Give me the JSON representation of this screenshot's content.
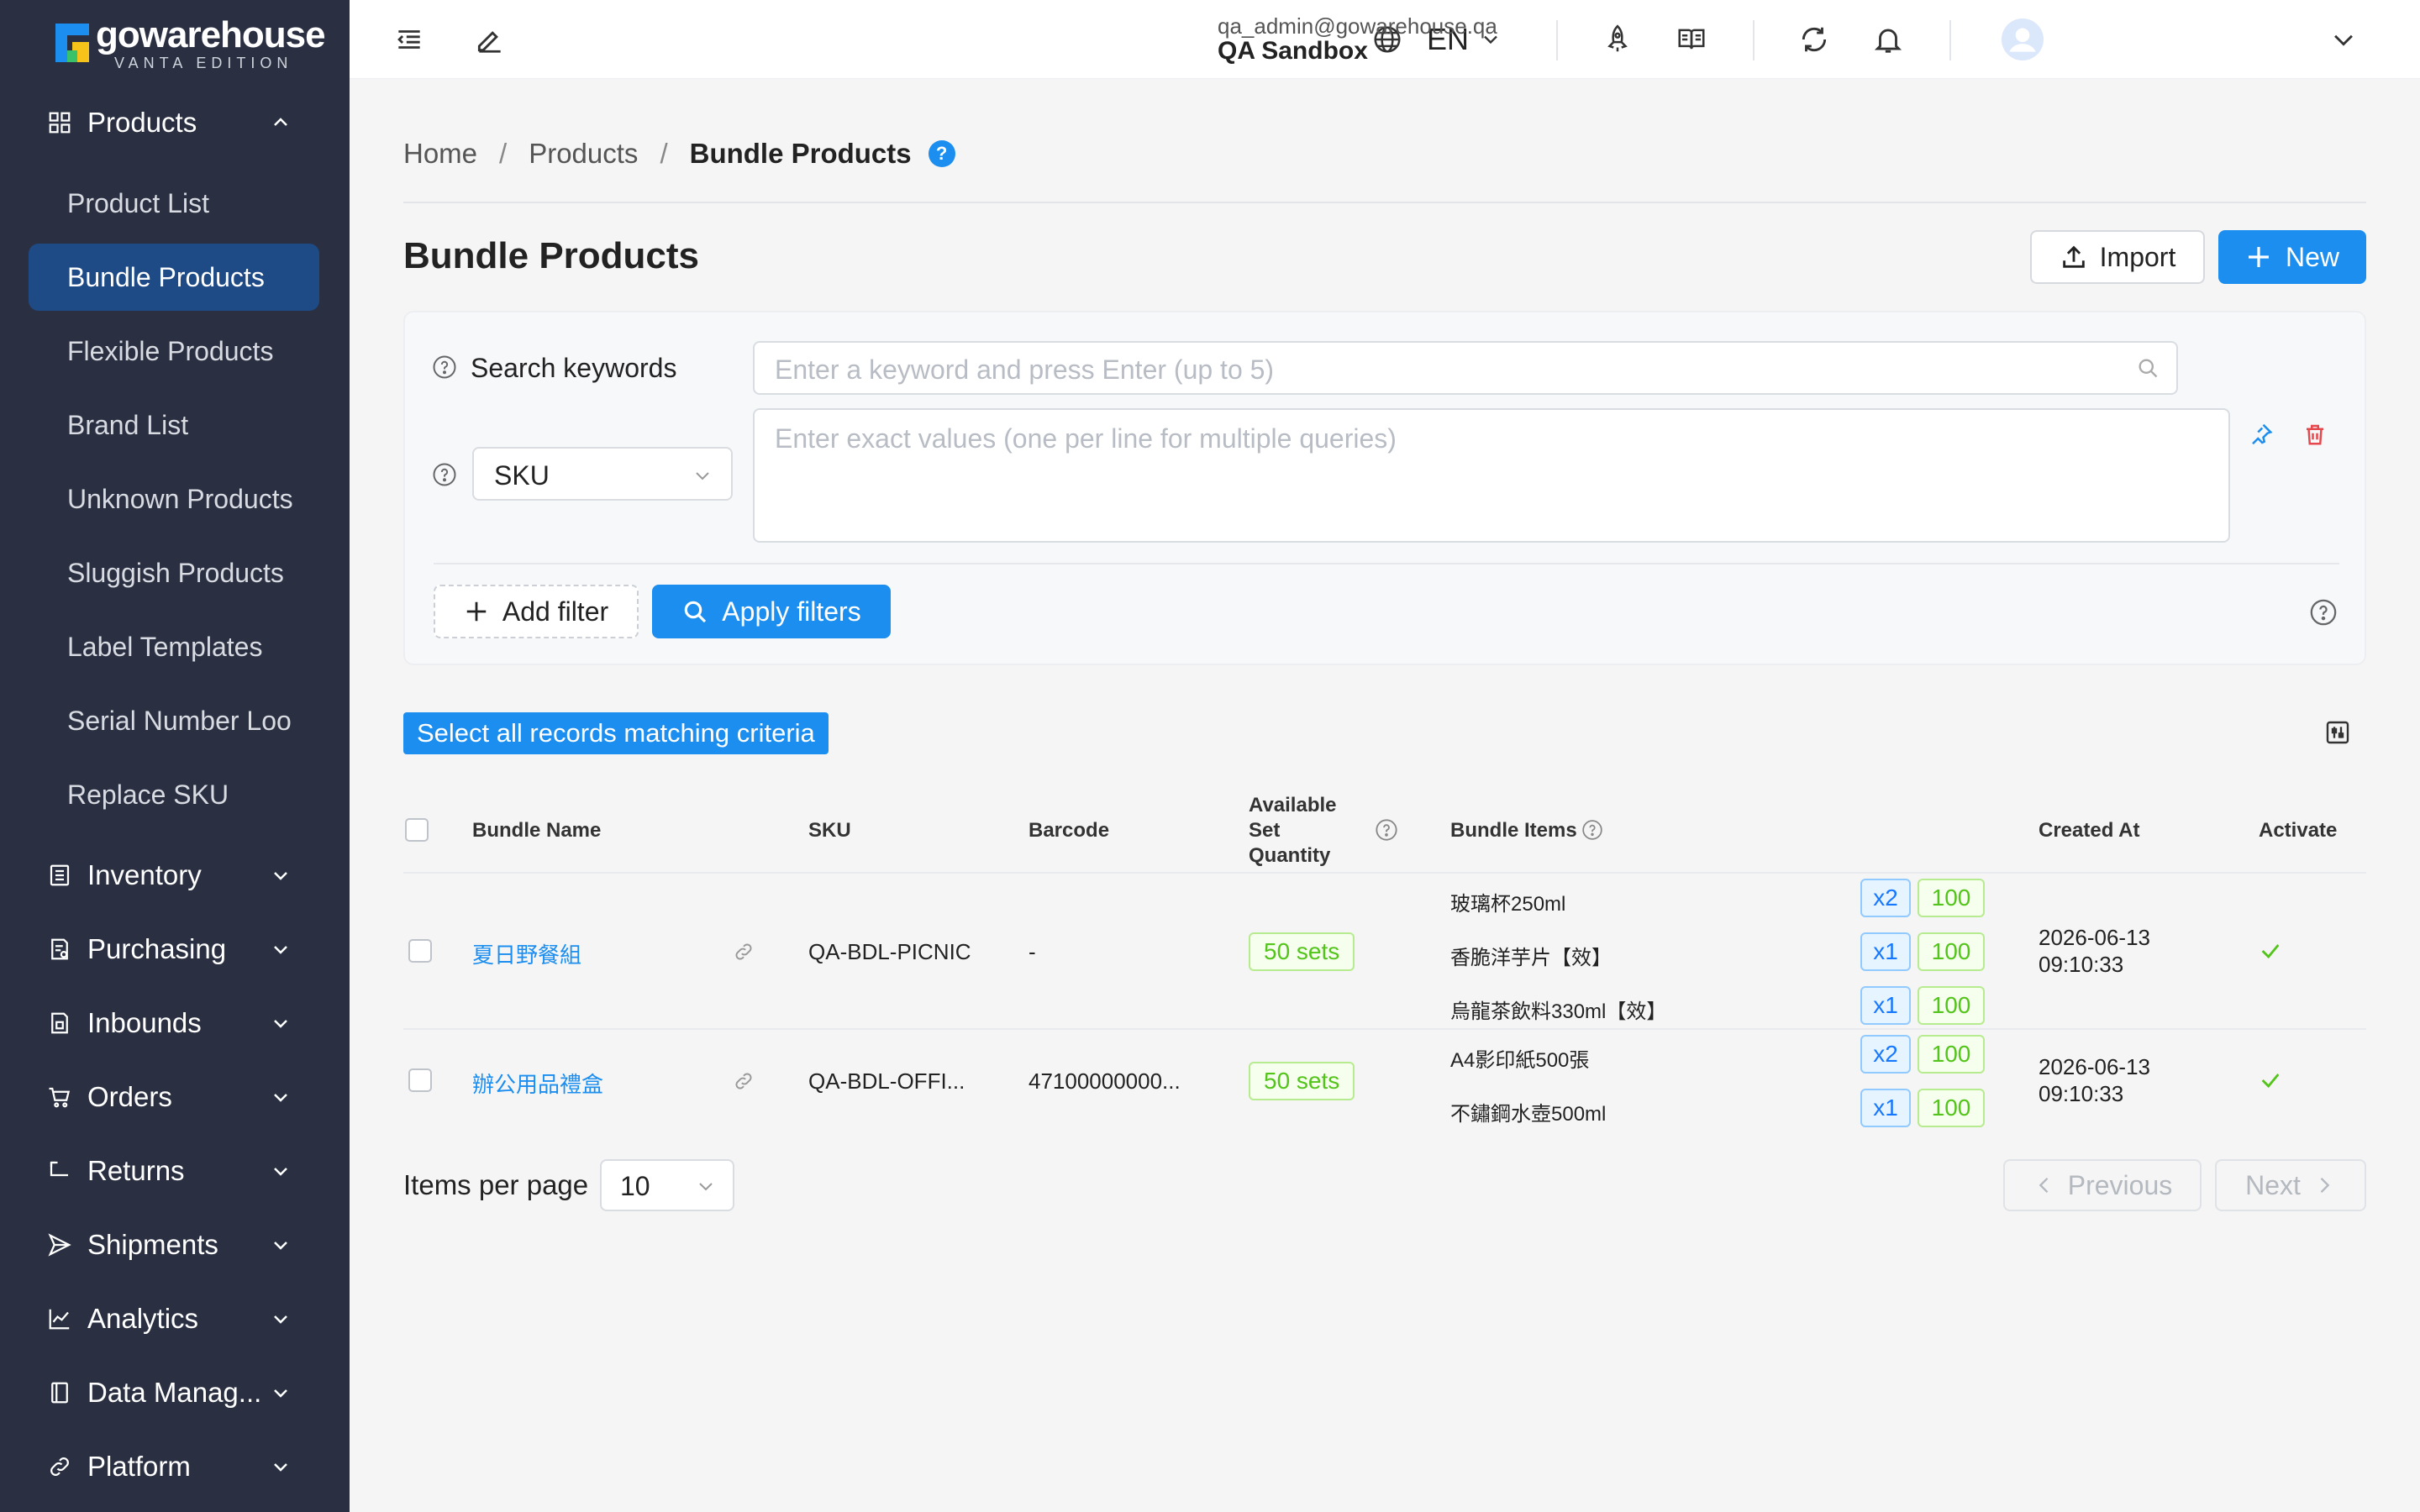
{
  "app": {
    "logo_name": "gowarehouse",
    "logo_sub": "VANTA EDITION"
  },
  "sidebar": {
    "products_label": "Products",
    "product_items": [
      {
        "label": "Product List"
      },
      {
        "label": "Bundle Products"
      },
      {
        "label": "Flexible Products"
      },
      {
        "label": "Brand List"
      },
      {
        "label": "Unknown Products"
      },
      {
        "label": "Sluggish Products"
      },
      {
        "label": "Label Templates"
      },
      {
        "label": "Serial Number Loo"
      },
      {
        "label": "Replace SKU"
      }
    ],
    "groups": [
      {
        "label": "Inventory"
      },
      {
        "label": "Purchasing"
      },
      {
        "label": "Inbounds"
      },
      {
        "label": "Orders"
      },
      {
        "label": "Returns"
      },
      {
        "label": "Shipments"
      },
      {
        "label": "Analytics"
      },
      {
        "label": "Data Manag..."
      },
      {
        "label": "Platform"
      }
    ]
  },
  "header": {
    "language": "EN",
    "user_email": "qa_admin@gowarehouse.qa",
    "user_org": "QA Sandbox"
  },
  "breadcrumb": {
    "home": "Home",
    "products": "Products",
    "current": "Bundle Products",
    "help": "?"
  },
  "page": {
    "title": "Bundle Products",
    "import_label": "Import",
    "new_label": "New"
  },
  "filters": {
    "search_label": "Search keywords",
    "search_placeholder": "Enter a keyword and press Enter (up to 5)",
    "field_select": "SKU",
    "exact_placeholder": "Enter exact values (one per line for multiple queries)",
    "add_filter_label": "Add filter",
    "apply_label": "Apply filters"
  },
  "select_all_label": "Select all records matching criteria",
  "table": {
    "headers": {
      "bundle_name": "Bundle Name",
      "sku": "SKU",
      "barcode": "Barcode",
      "available_1": "Available",
      "available_2": "Set",
      "available_3": "Quantity",
      "bundle_items": "Bundle Items",
      "created_at": "Created At",
      "activate": "Activate"
    },
    "rows": [
      {
        "name": "夏日野餐組",
        "sku": "QA-BDL-PICNIC",
        "barcode": "-",
        "available": "50 sets",
        "items": [
          {
            "name": "玻璃杯250ml",
            "qty": "x2",
            "stock": "100"
          },
          {
            "name": "香脆洋芋片【效】",
            "qty": "x1",
            "stock": "100"
          },
          {
            "name": "烏龍茶飲料330ml【效】",
            "qty": "x1",
            "stock": "100"
          }
        ],
        "created_date": "2026-06-13",
        "created_time": "09:10:33"
      },
      {
        "name": "辦公用品禮盒",
        "sku": "QA-BDL-OFFI...",
        "barcode": "47100000000...",
        "available": "50 sets",
        "items": [
          {
            "name": "A4影印紙500張",
            "qty": "x2",
            "stock": "100"
          },
          {
            "name": "不鏽鋼水壺500ml",
            "qty": "x1",
            "stock": "100"
          }
        ],
        "created_date": "2026-06-13",
        "created_time": "09:10:33"
      }
    ]
  },
  "pagination": {
    "items_per_page_label": "Items per page",
    "items_per_page": "10",
    "previous": "Previous",
    "next": "Next"
  },
  "colors": {
    "sidebar_bg": "#2a3042",
    "accent": "#1b8ef0",
    "active_item": "#1e4a86",
    "success": "#52c41a",
    "danger": "#e5484d"
  }
}
